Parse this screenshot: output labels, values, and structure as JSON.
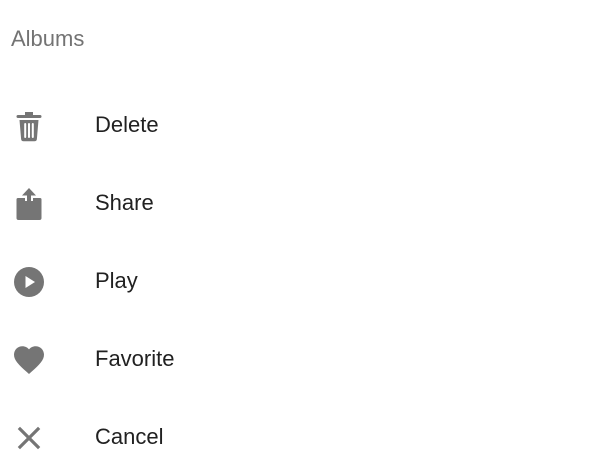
{
  "sheet": {
    "title": "Albums",
    "actions": [
      {
        "label": "Delete",
        "icon": "trash-icon"
      },
      {
        "label": "Share",
        "icon": "share-icon"
      },
      {
        "label": "Play",
        "icon": "play-icon"
      },
      {
        "label": "Favorite",
        "icon": "heart-icon"
      },
      {
        "label": "Cancel",
        "icon": "close-icon"
      }
    ]
  },
  "colors": {
    "icon": "#757575",
    "label": "#212121",
    "title": "#737373",
    "background": "#ffffff"
  }
}
